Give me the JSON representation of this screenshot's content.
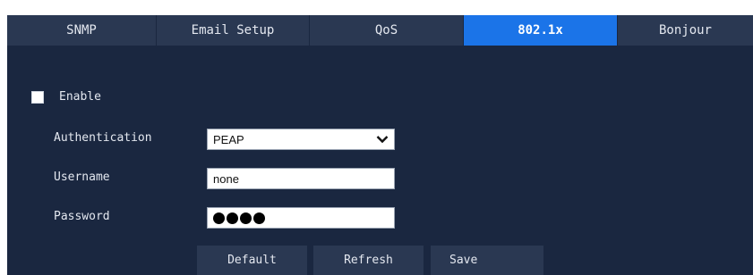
{
  "tabs": [
    {
      "label": "SNMP",
      "active": false
    },
    {
      "label": "Email Setup",
      "active": false
    },
    {
      "label": "QoS",
      "active": false
    },
    {
      "label": "802.1x",
      "active": true
    },
    {
      "label": "Bonjour",
      "active": false
    }
  ],
  "form": {
    "enable_label": "Enable",
    "enable_checked": false,
    "authentication_label": "Authentication",
    "authentication_value": "PEAP",
    "username_label": "Username",
    "username_value": "none",
    "password_label": "Password",
    "password_masked_length": 4
  },
  "buttons": {
    "default_label": "Default",
    "refresh_label": "Refresh",
    "save_label": "Save"
  },
  "colors": {
    "panel_bg": "#1a2740",
    "tab_bg": "#2a3852",
    "tab_active": "#1b74e8",
    "text": "#e4e8f0"
  },
  "icons": {
    "select_arrow": "chevron-down-icon",
    "password_mask": "password-dot-icon"
  }
}
